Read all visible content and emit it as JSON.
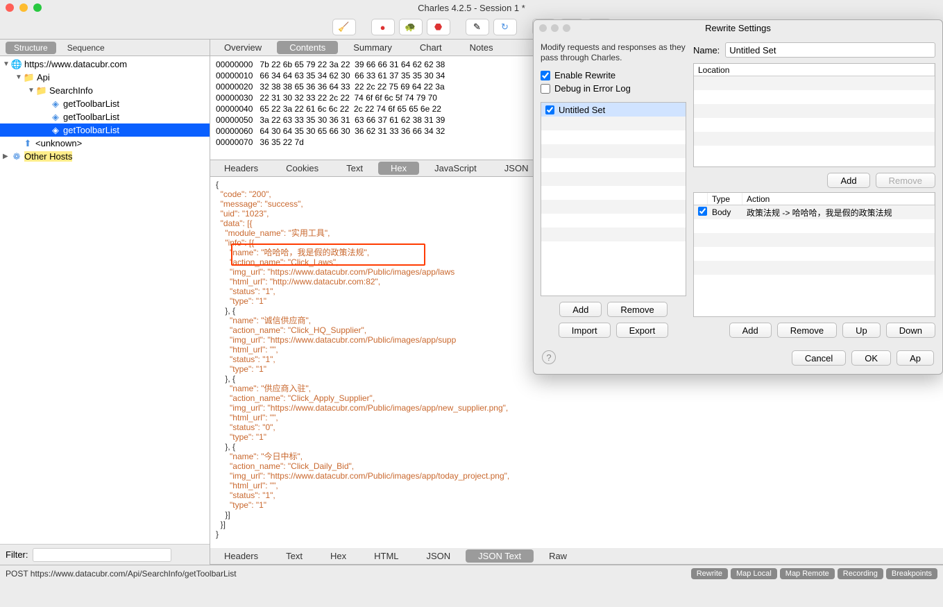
{
  "window": {
    "title": "Charles 4.2.5 - Session 1 *"
  },
  "sidebar_tabs": {
    "structure": "Structure",
    "sequence": "Sequence"
  },
  "tree": {
    "host": "https://www.datacubr.com",
    "api": "Api",
    "searchinfo": "SearchInfo",
    "items": [
      "getToolbarList",
      "getToolbarList",
      "getToolbarList"
    ],
    "unknown": "<unknown>",
    "other": "Other Hosts"
  },
  "filter_label": "Filter:",
  "top_tabs": {
    "overview": "Overview",
    "contents": "Contents",
    "summary": "Summary",
    "chart": "Chart",
    "notes": "Notes"
  },
  "mid_tabs": {
    "headers": "Headers",
    "cookies": "Cookies",
    "text": "Text",
    "hex": "Hex",
    "javascript": "JavaScript",
    "json": "JSON",
    "jsont": "JS"
  },
  "bot_tabs": {
    "headers": "Headers",
    "text": "Text",
    "hex": "Hex",
    "html": "HTML",
    "json": "JSON",
    "jsontext": "JSON Text",
    "raw": "Raw"
  },
  "hex_lines": [
    "00000000   7b 22 6b 65 79 22 3a 22  39 66 66 31 64 62 62 38",
    "00000010   66 34 64 63 35 34 62 30  66 33 61 37 35 35 30 34",
    "00000020   32 38 38 65 36 36 64 33  22 2c 22 75 69 64 22 3a",
    "00000030   22 31 30 32 33 22 2c 22  74 6f 6f 6c 5f 74 79 70",
    "00000040   65 22 3a 22 61 6c 6c 22  2c 22 74 6f 65 65 6e 22",
    "00000050   3a 22 63 33 35 30 36 31  63 66 37 61 62 38 31 39",
    "00000060   64 30 64 35 30 65 66 30  36 62 31 33 36 66 34 32",
    "00000070   36 35 22 7d"
  ],
  "json_body": {
    "l1": "{",
    "l2": "  \"code\": \"200\",",
    "l3": "  \"message\": \"success\",",
    "l4": "  \"uid\": \"1023\",",
    "l5": "  \"data\": [{",
    "l6": "    \"module_name\": \"实用工具\",",
    "l7": "    \"info\": [{",
    "l8": "      \"name\": \"哈哈哈，我是假的政策法规\",",
    "l9": "      \"action_name\": \"Click_Laws\",",
    "l10": "      \"img_url\": \"https://www.datacubr.com/Public/images/app/laws",
    "l11": "      \"html_url\": \"http://www.datacubr.com:82\",",
    "l12": "      \"status\": \"1\",",
    "l13": "      \"type\": \"1\"",
    "l14": "    }, {",
    "l15": "      \"name\": \"诚信供应商\",",
    "l16": "      \"action_name\": \"Click_HQ_Supplier\",",
    "l17": "      \"img_url\": \"https://www.datacubr.com/Public/images/app/supp",
    "l18": "      \"html_url\": \"\",",
    "l19": "      \"status\": \"1\",",
    "l20": "      \"type\": \"1\"",
    "l21": "    }, {",
    "l22": "      \"name\": \"供应商入驻\",",
    "l23": "      \"action_name\": \"Click_Apply_Supplier\",",
    "l24": "      \"img_url\": \"https://www.datacubr.com/Public/images/app/new_supplier.png\",",
    "l25": "      \"html_url\": \"\",",
    "l26": "      \"status\": \"0\",",
    "l27": "      \"type\": \"1\"",
    "l28": "    }, {",
    "l29": "      \"name\": \"今日中标\",",
    "l30": "      \"action_name\": \"Click_Daily_Bid\",",
    "l31": "      \"img_url\": \"https://www.datacubr.com/Public/images/app/today_project.png\",",
    "l32": "      \"html_url\": \"\",",
    "l33": "      \"status\": \"1\",",
    "l34": "      \"type\": \"1\"",
    "l35": "    }]",
    "l36": "  }]",
    "l37": "}"
  },
  "status": {
    "left": "POST https://www.datacubr.com/Api/SearchInfo/getToolbarList",
    "btns": [
      "Rewrite",
      "Map Local",
      "Map Remote",
      "Recording",
      "Breakpoints"
    ]
  },
  "dialog": {
    "title": "Rewrite Settings",
    "desc": "Modify requests and responses as they pass through Charles.",
    "enable": "Enable Rewrite",
    "debug": "Debug in Error Log",
    "set_name": "Untitled Set",
    "name_label": "Name:",
    "name_value": "Untitled Set",
    "loc_header": "Location",
    "add": "Add",
    "remove": "Remove",
    "import": "Import",
    "export": "Export",
    "type_hdr": "Type",
    "action_hdr": "Action",
    "rule_type": "Body",
    "rule_action": "政策法规 -> 哈哈哈，我是假的政策法规",
    "up": "Up",
    "down": "Down",
    "cancel": "Cancel",
    "ok": "OK",
    "apply": "Ap"
  }
}
